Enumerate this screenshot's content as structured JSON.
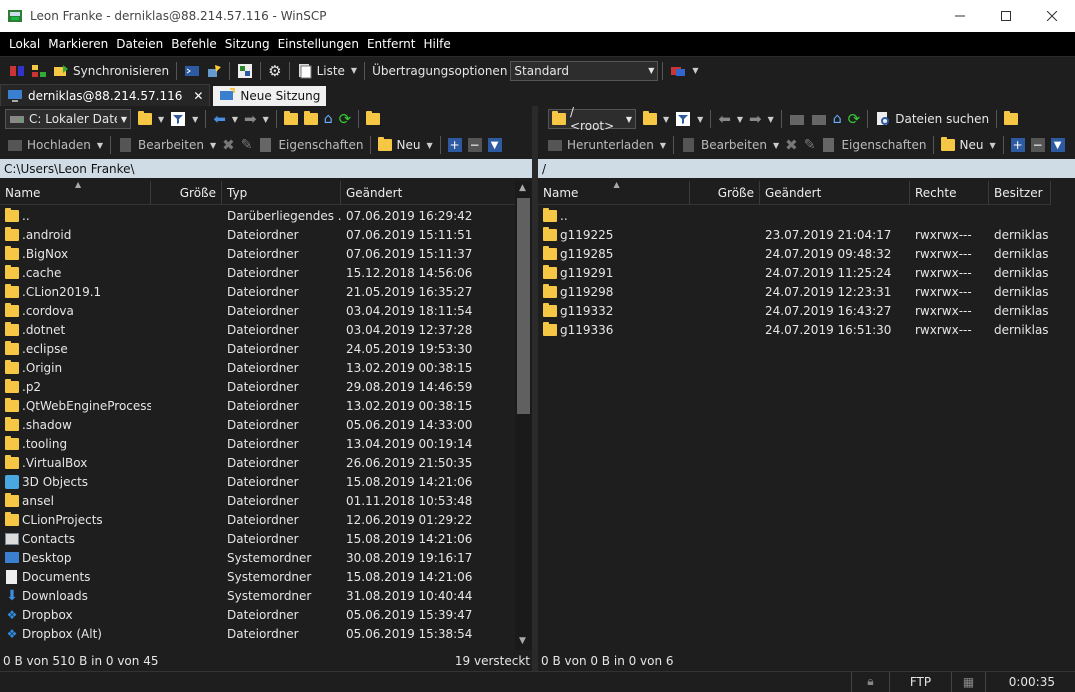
{
  "window": {
    "title": "Leon Franke - derniklas@88.214.57.116 - WinSCP"
  },
  "menu": [
    "Lokal",
    "Markieren",
    "Dateien",
    "Befehle",
    "Sitzung",
    "Einstellungen",
    "Entfernt",
    "Hilfe"
  ],
  "toolbar": {
    "sync_label": "Synchronisieren",
    "liste_label": "Liste",
    "transfer_label": "Übertragungsoptionen",
    "transfer_value": "Standard"
  },
  "tabs": {
    "session": "derniklas@88.214.57.116",
    "new_session": "Neue Sitzung"
  },
  "local": {
    "drive": "C: Lokaler Datent",
    "upload": "Hochladen",
    "edit": "Bearbeiten",
    "properties": "Eigenschaften",
    "new": "Neu",
    "path": "C:\\Users\\Leon Franke\\",
    "columns": [
      "Name",
      "Größe",
      "Typ",
      "Geändert"
    ],
    "rows": [
      {
        "icon": "parent",
        "name": "..",
        "size": "",
        "type": "Darüberliegendes ...",
        "date": "07.06.2019  16:29:42"
      },
      {
        "icon": "folder",
        "name": ".android",
        "size": "",
        "type": "Dateiordner",
        "date": "07.06.2019  15:11:51"
      },
      {
        "icon": "folder",
        "name": ".BigNox",
        "size": "",
        "type": "Dateiordner",
        "date": "07.06.2019  15:11:37"
      },
      {
        "icon": "folder",
        "name": ".cache",
        "size": "",
        "type": "Dateiordner",
        "date": "15.12.2018  14:56:06"
      },
      {
        "icon": "folder",
        "name": ".CLion2019.1",
        "size": "",
        "type": "Dateiordner",
        "date": "21.05.2019  16:35:27"
      },
      {
        "icon": "folder",
        "name": ".cordova",
        "size": "",
        "type": "Dateiordner",
        "date": "03.04.2019  18:11:54"
      },
      {
        "icon": "folder",
        "name": ".dotnet",
        "size": "",
        "type": "Dateiordner",
        "date": "03.04.2019  12:37:28"
      },
      {
        "icon": "folder",
        "name": ".eclipse",
        "size": "",
        "type": "Dateiordner",
        "date": "24.05.2019  19:53:30"
      },
      {
        "icon": "folder",
        "name": ".Origin",
        "size": "",
        "type": "Dateiordner",
        "date": "13.02.2019  00:38:15"
      },
      {
        "icon": "folder",
        "name": ".p2",
        "size": "",
        "type": "Dateiordner",
        "date": "29.08.2019  14:46:59"
      },
      {
        "icon": "folder",
        "name": ".QtWebEngineProcess",
        "size": "",
        "type": "Dateiordner",
        "date": "13.02.2019  00:38:15"
      },
      {
        "icon": "folder",
        "name": ".shadow",
        "size": "",
        "type": "Dateiordner",
        "date": "05.06.2019  14:33:00"
      },
      {
        "icon": "folder",
        "name": ".tooling",
        "size": "",
        "type": "Dateiordner",
        "date": "13.04.2019  00:19:14"
      },
      {
        "icon": "folder",
        "name": ".VirtualBox",
        "size": "",
        "type": "Dateiordner",
        "date": "26.06.2019  21:50:35"
      },
      {
        "icon": "3d",
        "name": "3D Objects",
        "size": "",
        "type": "Dateiordner",
        "date": "15.08.2019  14:21:06"
      },
      {
        "icon": "folder",
        "name": "ansel",
        "size": "",
        "type": "Dateiordner",
        "date": "01.11.2018  10:53:48"
      },
      {
        "icon": "folder",
        "name": "CLionProjects",
        "size": "",
        "type": "Dateiordner",
        "date": "12.06.2019  01:29:22"
      },
      {
        "icon": "contacts",
        "name": "Contacts",
        "size": "",
        "type": "Dateiordner",
        "date": "15.08.2019  14:21:06"
      },
      {
        "icon": "desktop",
        "name": "Desktop",
        "size": "",
        "type": "Systemordner",
        "date": "30.08.2019  19:16:17"
      },
      {
        "icon": "documents",
        "name": "Documents",
        "size": "",
        "type": "Systemordner",
        "date": "15.08.2019  14:21:06"
      },
      {
        "icon": "downloads",
        "name": "Downloads",
        "size": "",
        "type": "Systemordner",
        "date": "31.08.2019  10:40:44"
      },
      {
        "icon": "dropbox",
        "name": "Dropbox",
        "size": "",
        "type": "Dateiordner",
        "date": "05.06.2019  15:39:47"
      },
      {
        "icon": "dropbox",
        "name": "Dropbox (Alt)",
        "size": "",
        "type": "Dateiordner",
        "date": "05.06.2019  15:38:54"
      }
    ],
    "status_left": "0 B von 510 B in 0 von 45",
    "status_right": "19 versteckt"
  },
  "remote": {
    "root": "/ <root>",
    "find": "Dateien suchen",
    "download": "Herunterladen",
    "edit": "Bearbeiten",
    "properties": "Eigenschaften",
    "new": "Neu",
    "path": "/",
    "columns": [
      "Name",
      "Größe",
      "Geändert",
      "Rechte",
      "Besitzer"
    ],
    "rows": [
      {
        "icon": "parent",
        "name": "..",
        "size": "",
        "date": "",
        "rights": "",
        "owner": ""
      },
      {
        "icon": "folder",
        "name": "g119225",
        "size": "",
        "date": "23.07.2019 21:04:17",
        "rights": "rwxrwx---",
        "owner": "derniklas"
      },
      {
        "icon": "folder",
        "name": "g119285",
        "size": "",
        "date": "24.07.2019 09:48:32",
        "rights": "rwxrwx---",
        "owner": "derniklas"
      },
      {
        "icon": "folder",
        "name": "g119291",
        "size": "",
        "date": "24.07.2019 11:25:24",
        "rights": "rwxrwx---",
        "owner": "derniklas"
      },
      {
        "icon": "folder",
        "name": "g119298",
        "size": "",
        "date": "24.07.2019 12:23:31",
        "rights": "rwxrwx---",
        "owner": "derniklas"
      },
      {
        "icon": "folder",
        "name": "g119332",
        "size": "",
        "date": "24.07.2019 16:43:27",
        "rights": "rwxrwx---",
        "owner": "derniklas"
      },
      {
        "icon": "folder",
        "name": "g119336",
        "size": "",
        "date": "24.07.2019 16:51:30",
        "rights": "rwxrwx---",
        "owner": "derniklas"
      }
    ],
    "status_left": "0 B von 0 B in 0 von 6"
  },
  "bottom": {
    "protocol": "FTP",
    "time": "0:00:35"
  }
}
